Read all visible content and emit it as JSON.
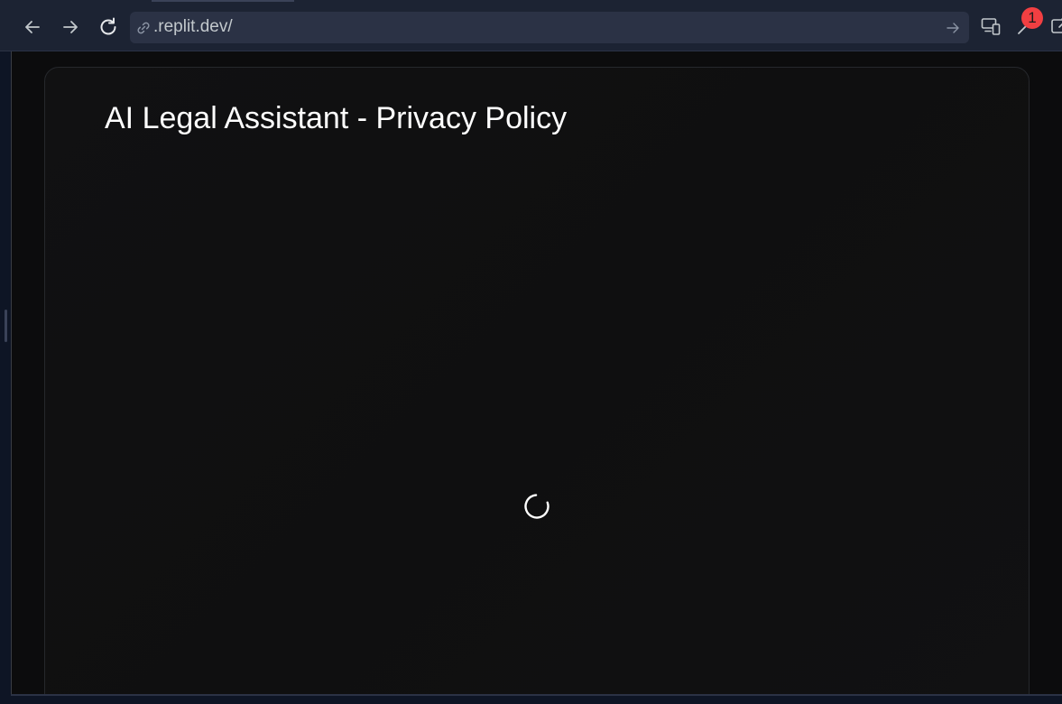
{
  "browser": {
    "url": ".replit.dev/",
    "nav": {
      "back_icon": "arrow-left-icon",
      "forward_icon": "arrow-right-icon",
      "reload_icon": "reload-icon"
    },
    "tools": {
      "devices_icon": "devices-icon",
      "devtools_icon": "wrench-icon",
      "devtools_badge": "1",
      "open_new_icon": "open-new-tab-icon"
    }
  },
  "page": {
    "title": "AI Legal Assistant - Privacy Policy",
    "loading": true
  },
  "colors": {
    "toolbar_bg": "#1c2333",
    "urlbar_bg": "#2b3245",
    "page_bg": "#0c0c0d",
    "badge": "#f23f42",
    "title_text": "#ffffff"
  }
}
